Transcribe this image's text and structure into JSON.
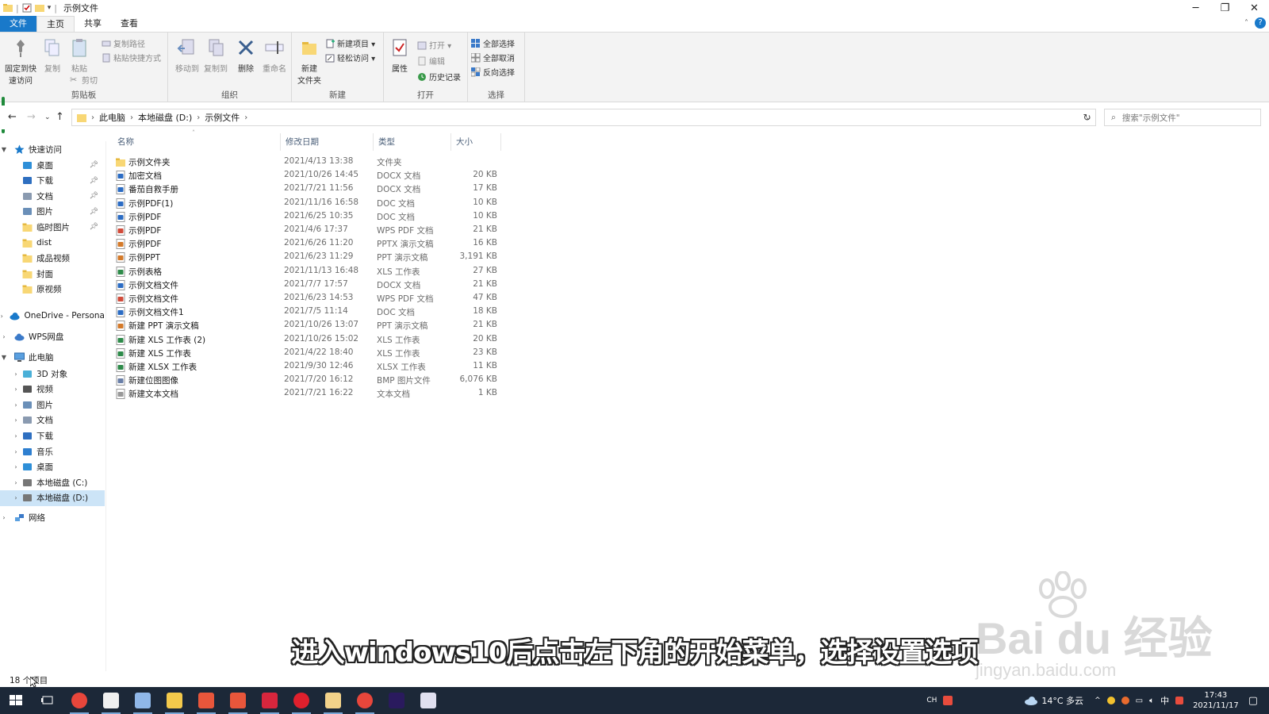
{
  "window": {
    "title": "示例文件",
    "controls": [
      "─",
      "❐",
      "✕"
    ]
  },
  "tabs": [
    {
      "label": "文件"
    },
    {
      "label": "主页"
    },
    {
      "label": "共享"
    },
    {
      "label": "查看"
    }
  ],
  "ribbon": {
    "clipboard": {
      "label": "剪贴板",
      "pin": "固定到快\n速访问",
      "copy": "复制",
      "paste": "粘贴",
      "copy_path": "复制路径",
      "paste_shortcut": "粘贴快捷方式",
      "cut": "剪切"
    },
    "organize": {
      "label": "组织",
      "move_to": "移动到",
      "copy_to": "复制到",
      "delete": "删除",
      "rename": "重命名"
    },
    "new": {
      "label": "新建",
      "new_folder": "新建\n文件夹",
      "new_item": "新建项目 ▾",
      "easy_access": "轻松访问 ▾"
    },
    "open": {
      "label": "打开",
      "properties": "属性",
      "open": "打开 ▾",
      "edit": "编辑",
      "history": "历史记录"
    },
    "select": {
      "label": "选择",
      "select_all": "全部选择",
      "select_none": "全部取消",
      "invert": "反向选择"
    }
  },
  "address": {
    "crumbs": [
      "此电脑",
      "本地磁盘 (D:)",
      "示例文件"
    ],
    "search_placeholder": "搜索\"示例文件\""
  },
  "navpane": {
    "quick_access": "快速访问",
    "quick_items": [
      {
        "label": "桌面",
        "icon": "desktop-icon",
        "pinned": true
      },
      {
        "label": "下载",
        "icon": "download-icon",
        "pinned": true
      },
      {
        "label": "文档",
        "icon": "document-icon",
        "pinned": true
      },
      {
        "label": "图片",
        "icon": "pictures-icon",
        "pinned": true
      },
      {
        "label": "临时图片",
        "icon": "folder-icon",
        "pinned": true
      },
      {
        "label": "dist",
        "icon": "folder-icon",
        "pinned": false
      },
      {
        "label": "成品视频",
        "icon": "folder-icon",
        "pinned": false
      },
      {
        "label": "封面",
        "icon": "folder-icon",
        "pinned": false
      },
      {
        "label": "原视频",
        "icon": "folder-icon",
        "pinned": false
      }
    ],
    "onedrive": "OneDrive - Persona",
    "wps": "WPS网盘",
    "this_pc": "此电脑",
    "pc_items": [
      {
        "label": "3D 对象",
        "icon": "3d-objects-icon"
      },
      {
        "label": "视频",
        "icon": "video-icon"
      },
      {
        "label": "图片",
        "icon": "pictures-icon"
      },
      {
        "label": "文档",
        "icon": "document-icon"
      },
      {
        "label": "下载",
        "icon": "download-icon"
      },
      {
        "label": "音乐",
        "icon": "music-icon"
      },
      {
        "label": "桌面",
        "icon": "desktop-icon"
      },
      {
        "label": "本地磁盘 (C:)",
        "icon": "drive-icon"
      },
      {
        "label": "本地磁盘 (D:)",
        "icon": "drive-icon",
        "selected": true
      }
    ],
    "network": "网络"
  },
  "columns": {
    "name": "名称",
    "date": "修改日期",
    "type": "类型",
    "size": "大小"
  },
  "files": [
    {
      "name": "示例文件夹",
      "date": "2021/4/13 13:38",
      "type": "文件夹",
      "size": "",
      "kind": "folder"
    },
    {
      "name": "加密文档",
      "date": "2021/10/26 14:45",
      "type": "DOCX 文档",
      "size": "20 KB",
      "kind": "doc"
    },
    {
      "name": "番茄自救手册",
      "date": "2021/7/21 11:56",
      "type": "DOCX 文档",
      "size": "17 KB",
      "kind": "doc"
    },
    {
      "name": "示例PDF(1)",
      "date": "2021/11/16 16:58",
      "type": "DOC 文档",
      "size": "10 KB",
      "kind": "doc"
    },
    {
      "name": "示例PDF",
      "date": "2021/6/25 10:35",
      "type": "DOC 文档",
      "size": "10 KB",
      "kind": "doc"
    },
    {
      "name": "示例PDF",
      "date": "2021/4/6 17:37",
      "type": "WPS PDF 文档",
      "size": "21 KB",
      "kind": "pdf"
    },
    {
      "name": "示例PDF",
      "date": "2021/6/26 11:20",
      "type": "PPTX 演示文稿",
      "size": "16 KB",
      "kind": "ppt"
    },
    {
      "name": "示例PPT",
      "date": "2021/6/23 11:29",
      "type": "PPT 演示文稿",
      "size": "3,191 KB",
      "kind": "ppt"
    },
    {
      "name": "示例表格",
      "date": "2021/11/13 16:48",
      "type": "XLS 工作表",
      "size": "27 KB",
      "kind": "xls"
    },
    {
      "name": "示例文档文件",
      "date": "2021/7/7 17:57",
      "type": "DOCX 文档",
      "size": "21 KB",
      "kind": "doc"
    },
    {
      "name": "示例文档文件",
      "date": "2021/6/23 14:53",
      "type": "WPS PDF 文档",
      "size": "47 KB",
      "kind": "pdf"
    },
    {
      "name": "示例文档文件1",
      "date": "2021/7/5 11:14",
      "type": "DOC 文档",
      "size": "18 KB",
      "kind": "doc"
    },
    {
      "name": "新建 PPT 演示文稿",
      "date": "2021/10/26 13:07",
      "type": "PPT 演示文稿",
      "size": "21 KB",
      "kind": "ppt"
    },
    {
      "name": "新建 XLS 工作表 (2)",
      "date": "2021/10/26 15:02",
      "type": "XLS 工作表",
      "size": "20 KB",
      "kind": "xls"
    },
    {
      "name": "新建 XLS 工作表",
      "date": "2021/4/22 18:40",
      "type": "XLS 工作表",
      "size": "23 KB",
      "kind": "xls"
    },
    {
      "name": "新建 XLSX 工作表",
      "date": "2021/9/30 12:46",
      "type": "XLSX 工作表",
      "size": "11 KB",
      "kind": "xls"
    },
    {
      "name": "新建位图图像",
      "date": "2021/7/20 16:12",
      "type": "BMP 图片文件",
      "size": "6,076 KB",
      "kind": "bmp"
    },
    {
      "name": "新建文本文档",
      "date": "2021/7/21 16:22",
      "type": "文本文档",
      "size": "1 KB",
      "kind": "txt"
    }
  ],
  "status": "18 个项目",
  "subtitle": "进入windows10后点击左下角的开始菜单，选择设置选项",
  "watermark": {
    "main": "Bai du 经验",
    "sub": "jingyan.baidu.com"
  },
  "taskbar": {
    "apps": [
      "start-icon",
      "task-view-icon",
      "chrome-icon",
      "app-icon",
      "notes-icon",
      "file-explorer-icon",
      "app-icon",
      "app-icon",
      "wps-icon",
      "netease-music-icon",
      "app-icon",
      "chrome-icon",
      "premiere-icon",
      "app-icon"
    ],
    "ime": "CH",
    "weather": "14°C 多云",
    "ime_lang": "中",
    "time": "17:43",
    "date": "2021/11/17"
  },
  "colors": {
    "accent": "#1979ca",
    "selection": "#cce4f7",
    "taskbar": "#1c2838",
    "folder": "#f8d775"
  }
}
